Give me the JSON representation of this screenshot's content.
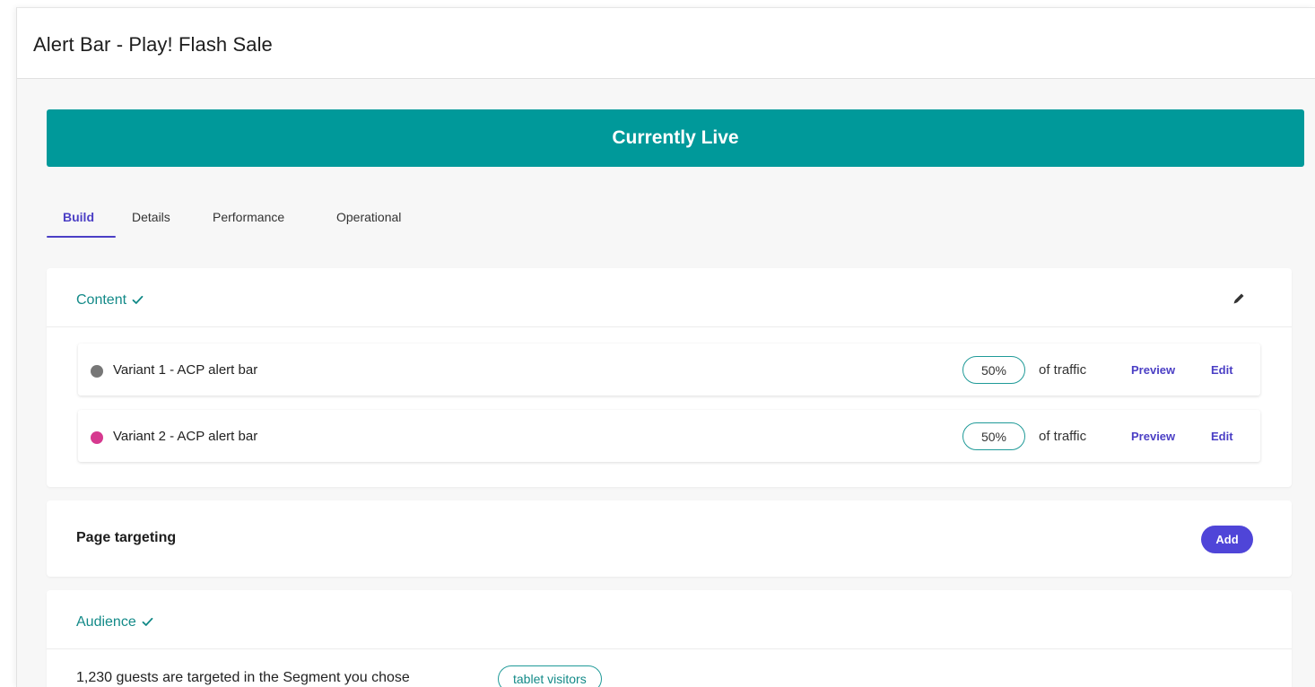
{
  "header": {
    "title": "Alert Bar - Play! Flash Sale"
  },
  "status_banner": {
    "label": "Currently Live",
    "color": "#00999a"
  },
  "tabs": [
    {
      "label": "Build",
      "active": true
    },
    {
      "label": "Details",
      "active": false
    },
    {
      "label": "Performance",
      "active": false
    },
    {
      "label": "Operational",
      "active": false
    }
  ],
  "content_section": {
    "title": "Content",
    "icon": "checkmark-icon",
    "edit_icon": "pencil-icon",
    "variants": [
      {
        "name": "Variant 1 - ACP alert bar",
        "dot_color": "#777777",
        "traffic_percent": "50%",
        "traffic_label": "of traffic",
        "preview_label": "Preview",
        "edit_label": "Edit"
      },
      {
        "name": "Variant 2 - ACP alert bar",
        "dot_color": "#d6398f",
        "traffic_percent": "50%",
        "traffic_label": "of traffic",
        "preview_label": "Preview",
        "edit_label": "Edit"
      }
    ]
  },
  "page_targeting": {
    "title": "Page targeting",
    "add_label": "Add"
  },
  "audience": {
    "title": "Audience",
    "icon": "checkmark-icon",
    "description": "1,230 guests are targeted in the Segment you chose",
    "segment": "tablet visitors"
  },
  "colors": {
    "accent": "#4b3fc5",
    "teal": "#138a88"
  }
}
